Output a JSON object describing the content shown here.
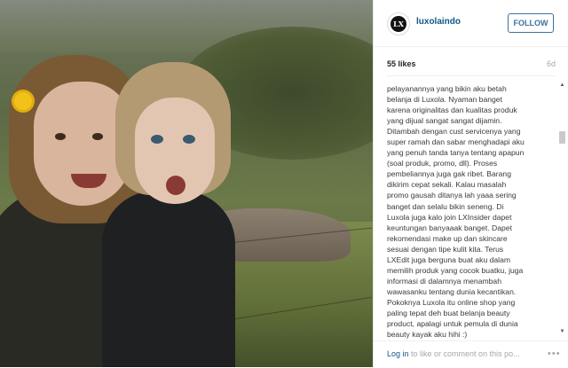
{
  "post": {
    "username": "luxolaindo",
    "follow_label": "FOLLOW",
    "likes": "55 likes",
    "age": "6d",
    "caption": "pelayanannya yang bikin aku betah\nbelanja di Luxola. Nyaman banget\nkarena originalitas dan kualitas produk\nyang dijual sangat sangat dijamin.\nDitambah dengan cust servicenya yang\nsuper ramah dan sabar menghadapi aku\nyang penuh tanda tanya tentang apapun\n(soal produk, promo, dll). Proses\npembeliannya juga gak ribet. Barang\ndikirim cepat sekali. Kalau masalah\npromo gausah ditanya lah yaaa sering\nbanget dan selalu bikin seneng. Di\nLuxola juga kalo join LXInsider dapet\nkeuntungan banyaaak banget. Dapet\nrekomendasi make up dan skincare\nsesuai dengan tipe kulit kita. Terus\nLXEdit juga berguna buat aku dalam\nmemilih produk yang cocok buatku, juga\ninformasi di dalamnya menambah\nwawasanku tentang dunia kecantikan.\nPokoknya Luxola itu online shop yang\npaling tepat deh buat belanja beauty\nproduct, apalagi untuk pemula di dunia\nbeauty kayak aku hihi :)",
    "comment_link": "Log in",
    "comment_rest": " to like or comment on this po...",
    "more_label": "•••"
  },
  "icons": {
    "avatar": "luxola-logo",
    "scroll_up": "arrow-up-icon",
    "scroll_down": "arrow-down-icon",
    "more": "more-options-icon"
  },
  "colors": {
    "link": "#125688",
    "follow_border": "#3f729b",
    "muted": "#a5a7aa"
  }
}
